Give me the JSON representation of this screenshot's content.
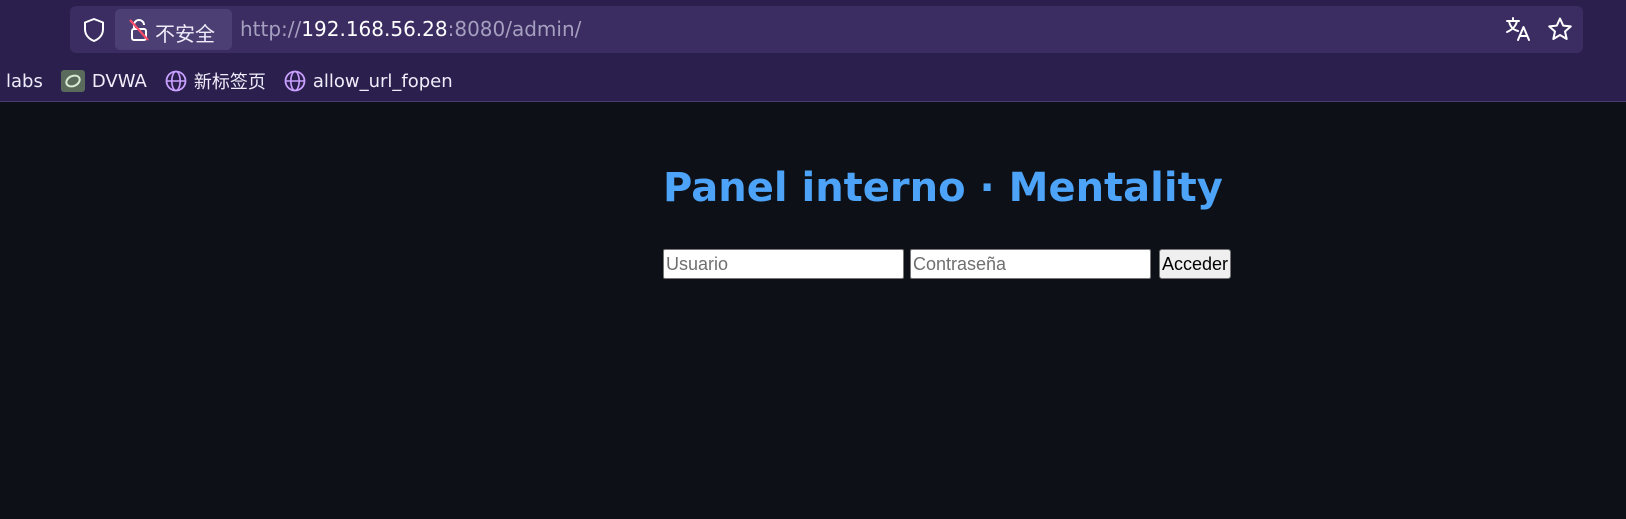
{
  "browser": {
    "security_label": "不安全",
    "url": {
      "scheme": "http://",
      "host": "192.168.56.28",
      "rest": ":8080/admin/"
    },
    "bookmarks": [
      {
        "label": "labs",
        "icon": "none"
      },
      {
        "label": "DVWA",
        "icon": "dvwa-favicon"
      },
      {
        "label": "新标签页",
        "icon": "globe-icon"
      },
      {
        "label": "allow_url_fopen",
        "icon": "globe-icon"
      }
    ],
    "colors": {
      "chrome_bg": "#2a1f4d",
      "urlbar_bg": "#3b2d61",
      "globe_icon": "#c9a0ff"
    }
  },
  "page": {
    "title": "Panel interno · Mentality",
    "form": {
      "username_placeholder": "Usuario",
      "password_placeholder": "Contraseña",
      "submit_label": "Acceder"
    },
    "colors": {
      "background": "#0d1017",
      "title": "#4da3f7"
    }
  }
}
